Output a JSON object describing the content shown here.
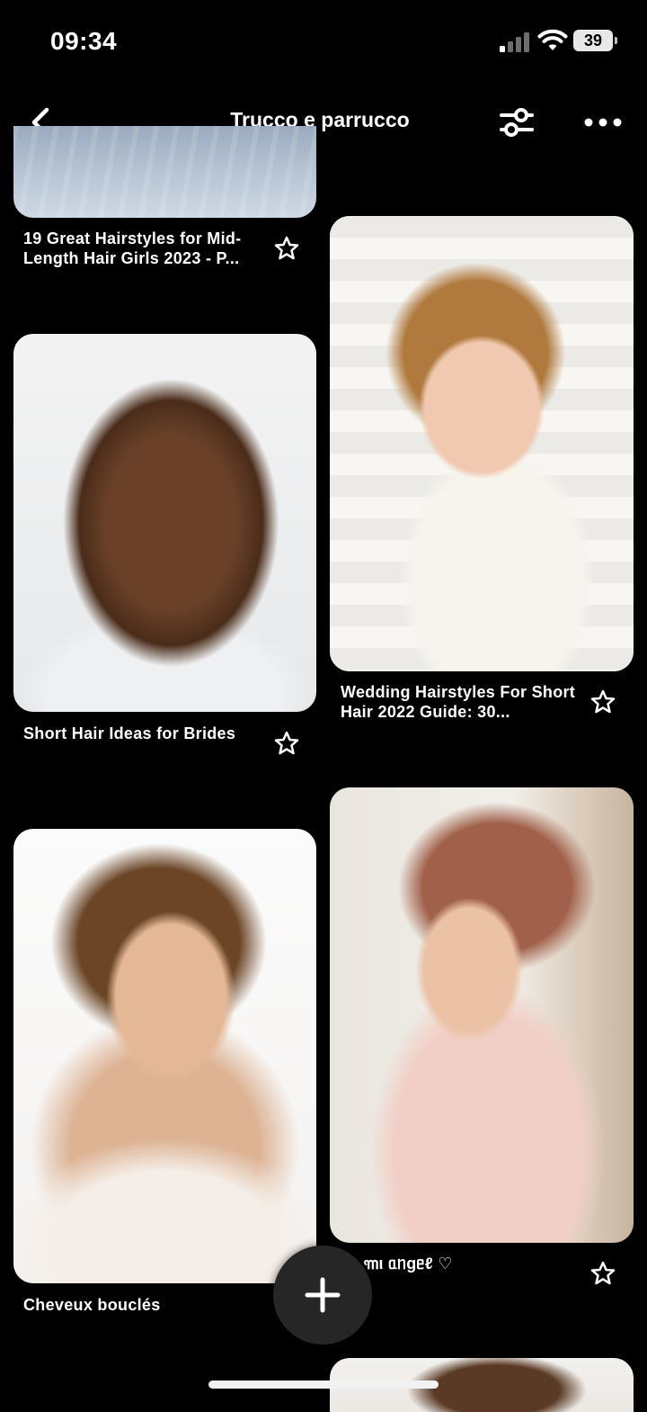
{
  "status": {
    "time": "09:34",
    "battery": "39"
  },
  "header": {
    "title": "Trucco e parrucco"
  },
  "pins": [
    {
      "caption": "19 Great Hairstyles for Mid-Length Hair Girls 2023 - P..."
    },
    {
      "caption": "Wedding Hairstyles For Short Hair 2022 Guide: 30..."
    },
    {
      "caption": "Short Hair Ideas for Brides"
    },
    {
      "caption": "Cheveux bouclés"
    },
    {
      "caption": "ᥒᥲ ꧑ι ᥲᥒgᥱℓ ♡"
    }
  ],
  "icons": {
    "back": "back-arrow-icon",
    "filter": "filter-sliders-icon",
    "more": "more-dots-icon",
    "save": "star-icon",
    "create": "plus-icon"
  },
  "colors": {
    "background": "#000000",
    "fab": "#262626"
  }
}
